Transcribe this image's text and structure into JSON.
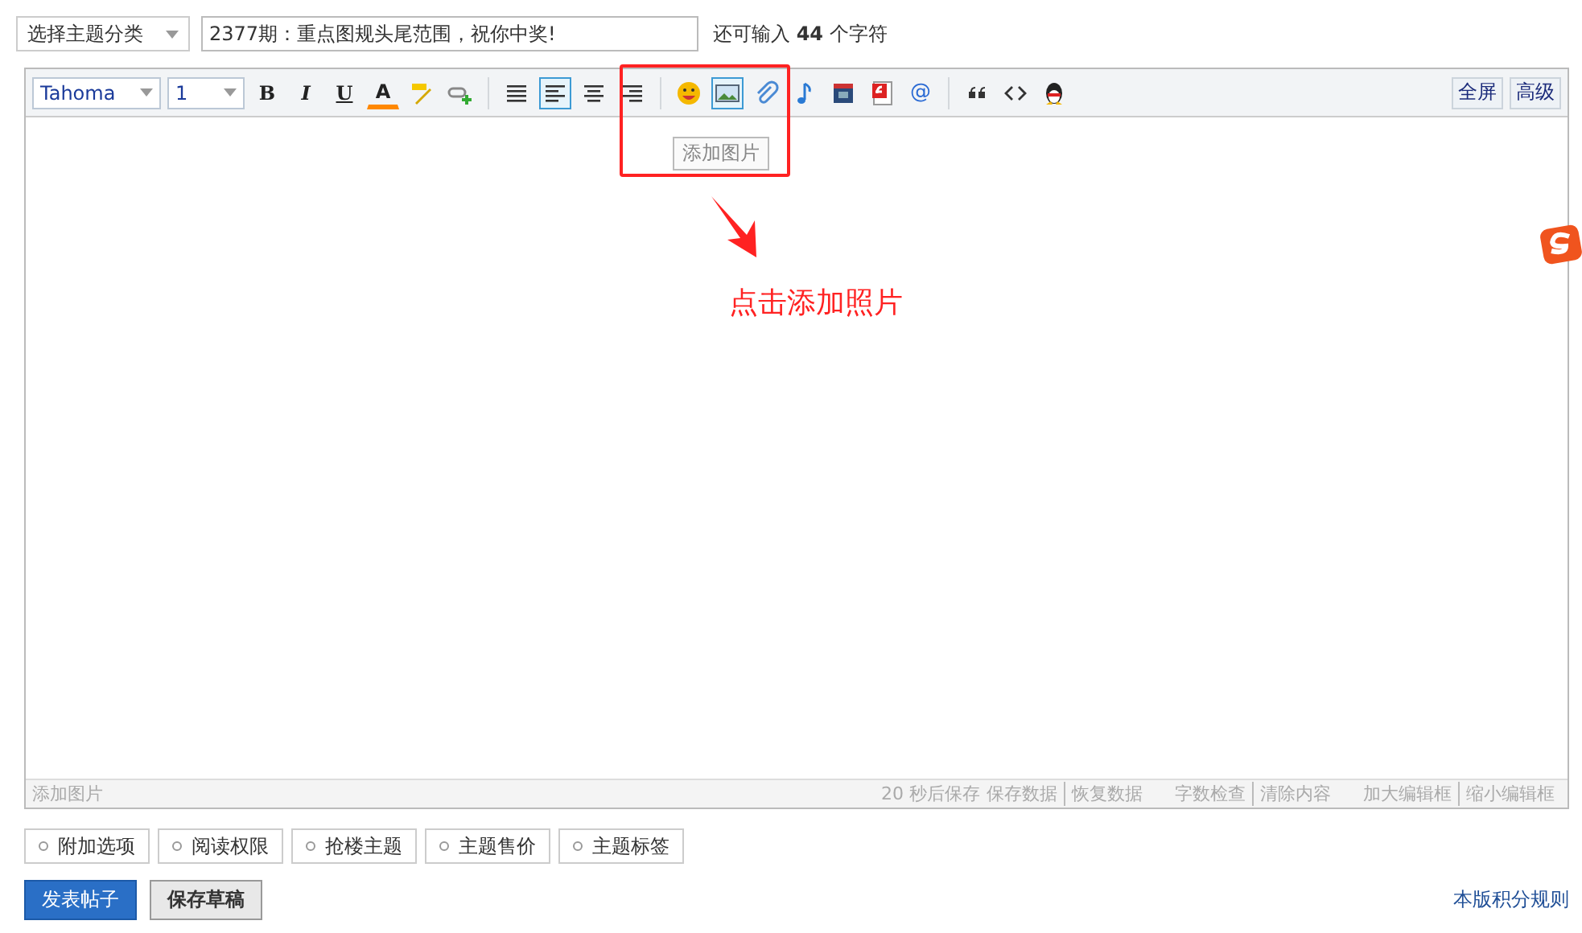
{
  "category_select": {
    "value": "选择主题分类"
  },
  "title_input": {
    "value": "2377期：重点图规头尾范围，祝你中奖!"
  },
  "char_counter": {
    "prefix": "还可输入",
    "count": "44",
    "suffix": "个字符"
  },
  "toolbar": {
    "font": "Tahoma",
    "size": "1",
    "groups": [
      [
        {
          "kind": "bold",
          "label": "B",
          "selected": false
        },
        {
          "kind": "italic",
          "label": "I",
          "selected": false
        },
        {
          "kind": "underline",
          "label": "U",
          "selected": false
        },
        {
          "kind": "color",
          "label": "A",
          "selected": false
        },
        {
          "kind": "highlight",
          "selected": false
        },
        {
          "kind": "link",
          "selected": false
        }
      ],
      [
        {
          "kind": "align-justify",
          "selected": false
        },
        {
          "kind": "align-left",
          "selected": true
        },
        {
          "kind": "align-center",
          "selected": false
        },
        {
          "kind": "align-right",
          "selected": false
        }
      ],
      [
        {
          "kind": "smiley",
          "selected": false
        },
        {
          "kind": "image",
          "selected": true
        },
        {
          "kind": "attach",
          "selected": false
        },
        {
          "kind": "music",
          "selected": false
        },
        {
          "kind": "video",
          "selected": false
        },
        {
          "kind": "flash",
          "selected": false
        },
        {
          "kind": "at",
          "label": "@",
          "selected": false
        }
      ],
      [
        {
          "kind": "quote",
          "selected": false
        },
        {
          "kind": "code",
          "selected": false
        },
        {
          "kind": "penguin",
          "selected": false
        }
      ]
    ],
    "view_buttons": [
      "全屏",
      "高级"
    ]
  },
  "tooltip": "添加图片",
  "annotation": {
    "text": "点击添加照片"
  },
  "footer": {
    "status": "添加图片",
    "autosave": "20 秒后保存",
    "link_groups": [
      [
        "保存数据",
        "恢复数据"
      ],
      [
        "字数检查",
        "清除内容"
      ],
      [
        "加大编辑框",
        "缩小编辑框"
      ]
    ]
  },
  "options": [
    "附加选项",
    "阅读权限",
    "抢楼主题",
    "主题售价",
    "主题标签"
  ],
  "actions": [
    {
      "label": "发表帖子",
      "kind": "primary"
    },
    {
      "label": "保存草稿",
      "kind": "secondary"
    }
  ],
  "rules_link": "本版积分规则"
}
